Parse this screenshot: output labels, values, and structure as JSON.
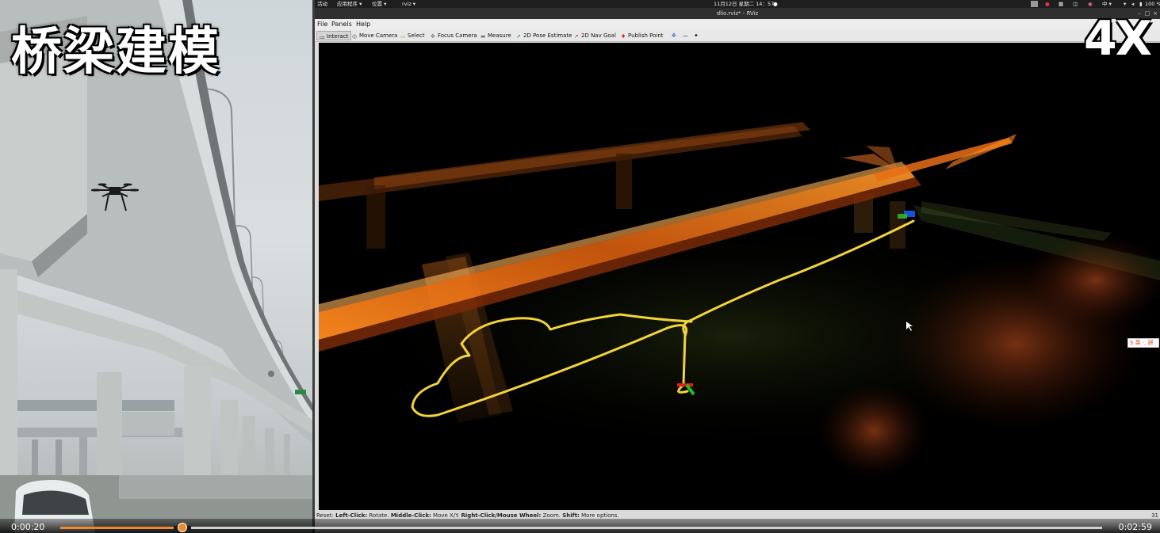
{
  "video": {
    "title": "桥梁建模",
    "speed_badge": "4X"
  },
  "desktop_topbar": {
    "activities": "活动",
    "applications": "应用程序 ▾",
    "places": "位置 ▾",
    "app_indicator": "rviz ▾",
    "clock": "11月12日 星期二 14：57",
    "input_method": "中 ▾",
    "battery": "100 %"
  },
  "window": {
    "title": "dlio.rviz* - RViz"
  },
  "menu": {
    "file": "File",
    "panels": "Panels",
    "help": "Help"
  },
  "toolbar": {
    "interact": "Interact",
    "move_camera": "Move Camera",
    "select": "Select",
    "focus_camera": "Focus Camera",
    "measure": "Measure",
    "pose_estimate": "2D Pose Estimate",
    "nav_goal": "2D Nav Goal",
    "publish_point": "Publish Point",
    "extra_icons": [
      "✥",
      "—",
      "✦"
    ]
  },
  "statusbar": {
    "reset": "Reset",
    "left_click_key": "Left-Click:",
    "left_click_val": "Rotate.",
    "middle_click_key": "Middle-Click:",
    "middle_click_val": "Move X/Y.",
    "right_click_key": "Right-Click/Mouse Wheel:",
    "right_click_val": "Zoom.",
    "shift_key": "Shift:",
    "shift_val": "More options.",
    "fps": "31"
  },
  "ime_badge": "S 英 ·, 拼",
  "player": {
    "current_time": "0:00:20",
    "total_time": "0:02:59",
    "progress": 0.11
  },
  "colors": {
    "trajectory": "#f2d43a",
    "cloud_hot": "#ff8a1e",
    "cloud_dark": "#7a2a08",
    "progress": "#f08a24"
  }
}
